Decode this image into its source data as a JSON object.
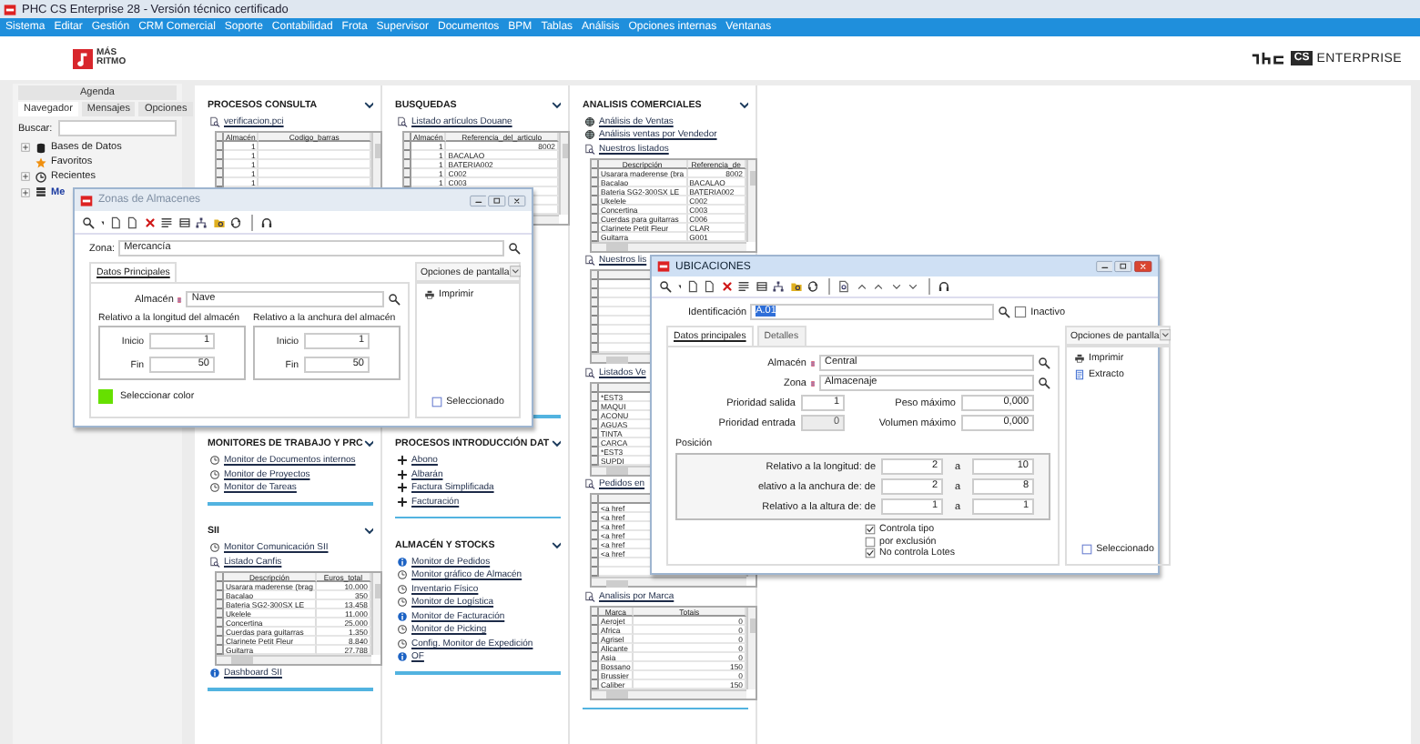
{
  "title_bar": {
    "title": "PHC CS Enterprise 28 - Versión técnico certificado"
  },
  "menu": [
    "Sistema",
    "Editar",
    "Gestión",
    "CRM Comercial",
    "Soporte",
    "Contabilidad",
    "Frota",
    "Supervisor",
    "Documentos",
    "BPM",
    "Tablas",
    "Análisis",
    "Opciones internas",
    "Ventanas"
  ],
  "header": {
    "logo_lines": [
      "MÁS",
      "RITMO"
    ],
    "badge": "CS",
    "product": "ENTERPRISE"
  },
  "navigator": {
    "top_tab": "Agenda",
    "tabs": [
      {
        "label": "Navegador",
        "selected": true
      },
      {
        "label": "Mensajes",
        "selected": false
      },
      {
        "label": "Opciones",
        "selected": false
      }
    ],
    "search_label": "Buscar:",
    "tree": [
      {
        "label": "Bases de Datos",
        "kind": "database"
      },
      {
        "label": "Favoritos",
        "kind": "star"
      },
      {
        "label": "Recientes",
        "kind": "clock"
      },
      {
        "label": "Me",
        "kind": "table"
      }
    ]
  },
  "columns": [
    [
      {
        "title": "PROCESOS CONSULTA",
        "items": [
          {
            "kind": "report",
            "label": "verificacion.pci"
          },
          {
            "kind": "grid",
            "columns": [
              "Almacén",
              "Codigo_barras"
            ],
            "rows": [
              [
                "1",
                ""
              ],
              [
                "1",
                ""
              ],
              [
                "1",
                ""
              ],
              [
                "1",
                ""
              ],
              [
                "1",
                ""
              ]
            ]
          }
        ]
      },
      {
        "title": "MONITORES DE TRABAJO Y PRC",
        "items": [
          {
            "kind": "clock",
            "label": "Monitor de Documentos internos"
          },
          {
            "kind": "clock",
            "label": "Monitor de Proyectos"
          },
          {
            "kind": "clock",
            "label": "Monitor de Tareas"
          }
        ]
      },
      {
        "title": "SII",
        "items": [
          {
            "kind": "clock",
            "label": "Monitor Comunicación SII"
          },
          {
            "kind": "report",
            "label": "Listado Canfis"
          },
          {
            "kind": "grid",
            "columns": [
              "Descripción",
              "Euros_total"
            ],
            "rows": [
              [
                "Usarara maderense (brag",
                "10.000"
              ],
              [
                "Bacalao",
                "350"
              ],
              [
                "Bateria SG2-300SX LE",
                "13.458"
              ],
              [
                "Ukelele",
                "11.000"
              ],
              [
                "Concertina",
                "25.000"
              ],
              [
                "Cuerdas para guitarras",
                "1.350"
              ],
              [
                "Clarinete Petit Fleur",
                "8.840"
              ],
              [
                "Guitarra",
                "27.788"
              ]
            ]
          },
          {
            "kind": "info",
            "label": "Dashboard SII"
          }
        ]
      }
    ],
    [
      {
        "title": "BUSQUEDAS",
        "items": [
          {
            "kind": "report",
            "label": "Listado artículos Douane"
          },
          {
            "kind": "grid",
            "columns": [
              "Almacén",
              "Referencia_del_articulo"
            ],
            "rows": [
              [
                "1",
                "8002"
              ],
              [
                "1",
                "BACALAO"
              ],
              [
                "1",
                "BATERIA002"
              ],
              [
                "1",
                "C002"
              ],
              [
                "1",
                "C003"
              ]
            ]
          }
        ]
      },
      {
        "title": "PROCESOS INTRODUCCIÓN DAT",
        "items": [
          {
            "kind": "plus",
            "label": "Abono"
          },
          {
            "kind": "plus",
            "label": "Albarán"
          },
          {
            "kind": "plus",
            "label": "Factura Simplificada"
          },
          {
            "kind": "plus",
            "label": "Facturación"
          }
        ]
      },
      {
        "title": "ALMACÉN Y STOCKS",
        "items": [
          {
            "kind": "info",
            "label": "Monitor de Pedidos"
          },
          {
            "kind": "clock",
            "label": "Monitor gráfico de Almacén"
          },
          {
            "kind": "clock",
            "label": "Inventario Físico"
          },
          {
            "kind": "clock",
            "label": "Monitor de Logística"
          },
          {
            "kind": "info",
            "label": "Monitor de Facturación"
          },
          {
            "kind": "clock",
            "label": "Monitor de Picking"
          },
          {
            "kind": "clock",
            "label": "Config. Monitor de Expedición"
          },
          {
            "kind": "info",
            "label": "OF"
          }
        ]
      }
    ],
    [
      {
        "title": "ANALISIS COMERCIALES",
        "items": [
          {
            "kind": "globe",
            "label": "Análisis de Ventas"
          },
          {
            "kind": "globe",
            "label": "Análisis ventas por Vendedor"
          },
          {
            "kind": "report",
            "label": "Nuestros listados"
          },
          {
            "kind": "grid",
            "columns": [
              "Descripción",
              "Referencia_de"
            ],
            "rows": [
              [
                "Usarara maderense (bra",
                "8002"
              ],
              [
                "Bacalao",
                "BACALAO"
              ],
              [
                "Bateria SG2-300SX LE",
                "BATERIA002"
              ],
              [
                "Ukelele",
                "C002"
              ],
              [
                "Concertina",
                "C003"
              ],
              [
                "Cuerdas para guitarras",
                "C006"
              ],
              [
                "Clarinete Petit Fleur",
                "CLAR"
              ],
              [
                "Guitarra",
                "G001"
              ]
            ]
          },
          {
            "kind": "report",
            "label": "Nuestros lis"
          },
          {
            "kind": "grid"
          },
          {
            "kind": "report",
            "label": "Listados Ve"
          },
          {
            "kind": "grid",
            "rows": [
              [
                "*EST3"
              ],
              [
                "MAQUI"
              ],
              [
                "ACONU"
              ],
              [
                "AGUAS"
              ],
              [
                "TINTA"
              ],
              [
                "CARCA"
              ],
              [
                "*EST3"
              ],
              [
                "SUPDI"
              ]
            ]
          },
          {
            "kind": "report",
            "label": "Pedidos en"
          },
          {
            "kind": "grid",
            "rows": [
              [
                "<a href"
              ],
              [
                "<a href"
              ],
              [
                "<a href"
              ],
              [
                "<a href"
              ],
              [
                "<a href"
              ],
              [
                "<a href"
              ]
            ]
          },
          {
            "kind": "report",
            "label": "Analisis por Marca"
          },
          {
            "kind": "grid",
            "columns": [
              "Marca",
              "Totais"
            ],
            "rows": [
              [
                "Aerojet",
                "0"
              ],
              [
                "Africa",
                "0"
              ],
              [
                "Agrisel",
                "0"
              ],
              [
                "Alicante",
                "0"
              ],
              [
                "Asia",
                "0"
              ],
              [
                "Bossano",
                "150"
              ],
              [
                "Brussier",
                "0"
              ],
              [
                "Caliber",
                "150"
              ]
            ]
          }
        ]
      }
    ]
  ],
  "zonas_window": {
    "title": "Zonas de Almacenes",
    "zona_label": "Zona:",
    "zona_value": "Mercancía",
    "tabs": [
      {
        "label": "Datos Principales",
        "selected": true
      }
    ],
    "almacen_label": "Almacén",
    "almacen_value": "Nave",
    "groups": [
      {
        "title": "Relativo a la longitud del almacén",
        "fields": [
          {
            "label": "Inicio",
            "value": "1"
          },
          {
            "label": "Fin",
            "value": "50"
          }
        ]
      },
      {
        "title": "Relativo a la anchura del almacén",
        "fields": [
          {
            "label": "Inicio",
            "value": "1"
          },
          {
            "label": "Fin",
            "value": "50"
          }
        ]
      }
    ],
    "color": "#66e000",
    "color_label": "Seleccionar color",
    "options_label": "Opciones de pantalla",
    "actions": [
      {
        "kind": "print",
        "label": "Imprimir"
      }
    ],
    "selected_label": "Seleccionado",
    "selected_checked": false
  },
  "ubicaciones_window": {
    "title": "UBICACIONES",
    "id_label": "Identificación",
    "id_value": "A.01",
    "inactive_label": "Inactivo",
    "inactive": false,
    "tabs": [
      {
        "label": "Datos principales",
        "selected": true
      },
      {
        "label": "Detalles",
        "selected": false
      }
    ],
    "lookups": [
      {
        "label": "Almacén",
        "value": "Central"
      },
      {
        "label": "Zona",
        "value": "Almacenaje"
      }
    ],
    "numbers": [
      {
        "label": "Prioridad salida",
        "value": "1",
        "disabled": false
      },
      {
        "label": "Peso máximo",
        "value": "0,000",
        "disabled": false
      },
      {
        "label": "Prioridad entrada",
        "value": "0",
        "disabled": true
      },
      {
        "label": "Volumen máximo",
        "value": "0,000",
        "disabled": false
      }
    ],
    "position_title": "Posición",
    "ranges": [
      {
        "label": "Relativo a la longitud: de",
        "from": "2",
        "sep": "a",
        "to": "10"
      },
      {
        "label": "elativo a la anchura de: de",
        "from": "2",
        "sep": "a",
        "to": "8"
      },
      {
        "label": "Relativo a la altura de: de",
        "from": "1",
        "sep": "a",
        "to": "1"
      }
    ],
    "checks": [
      {
        "label": "Controla tipo",
        "checked": true
      },
      {
        "label": "por exclusión",
        "checked": false
      },
      {
        "label": "No controla Lotes",
        "checked": true
      }
    ],
    "options_label": "Opciones de pantalla",
    "actions": [
      {
        "kind": "print",
        "label": "Imprimir"
      },
      {
        "kind": "extract",
        "label": "Extracto"
      }
    ],
    "selected_label": "Seleccionado",
    "selected_checked": false
  }
}
